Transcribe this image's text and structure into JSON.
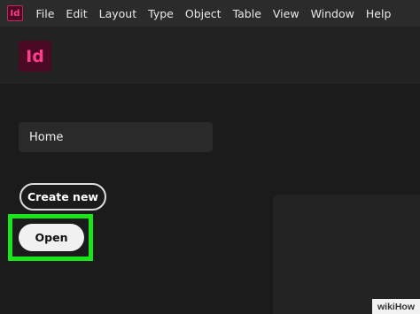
{
  "app": {
    "icon_label": "Id"
  },
  "menubar": {
    "items": [
      "File",
      "Edit",
      "Layout",
      "Type",
      "Object",
      "Table",
      "View",
      "Window",
      "Help"
    ]
  },
  "sidebar": {
    "home_label": "Home"
  },
  "actions": {
    "create_new_label": "Create new",
    "open_label": "Open"
  },
  "watermark": {
    "text": "wikiHow"
  },
  "colors": {
    "highlight": "#19e619",
    "app_accent": "#ff3d8b"
  }
}
